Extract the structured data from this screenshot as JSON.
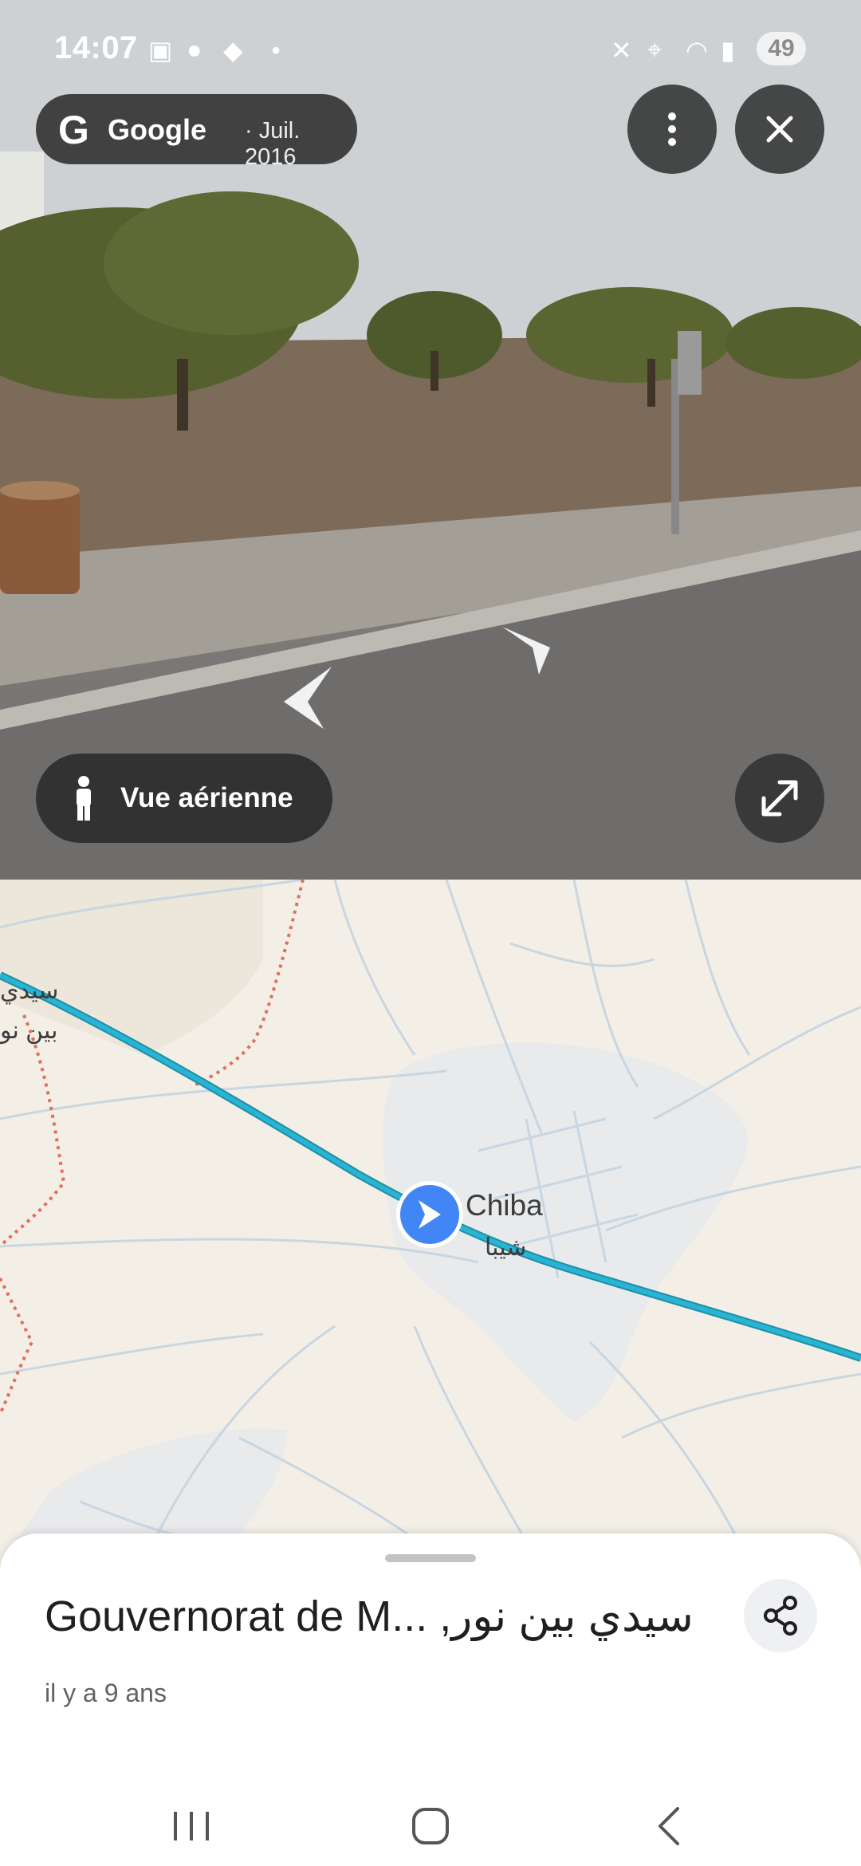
{
  "status_bar": {
    "time": "14:07",
    "battery": "49"
  },
  "street_view": {
    "brand": "Google",
    "capture_date": "· Juil. 2016",
    "aerial_view_label": "Vue aérienne",
    "menu_icon": "more-vert-icon",
    "close_icon": "close-icon",
    "expand_icon": "expand-icon",
    "pegman_icon": "pegman-icon"
  },
  "map": {
    "place_label": "Chiba",
    "place_label_ar": "شيبا",
    "edge_label_1": "سيدي",
    "edge_label_2": "بين نو",
    "route_color": "#28b4d2",
    "location_marker_color": "#4285f4"
  },
  "sheet": {
    "title": "Gouvernorat de M... ,سيدي بين نور",
    "subtitle": "il y a 9 ans",
    "share_icon": "share-icon"
  },
  "nav_bar": {
    "recents_icon": "recents-icon",
    "home_icon": "home-icon",
    "back_icon": "back-icon"
  }
}
